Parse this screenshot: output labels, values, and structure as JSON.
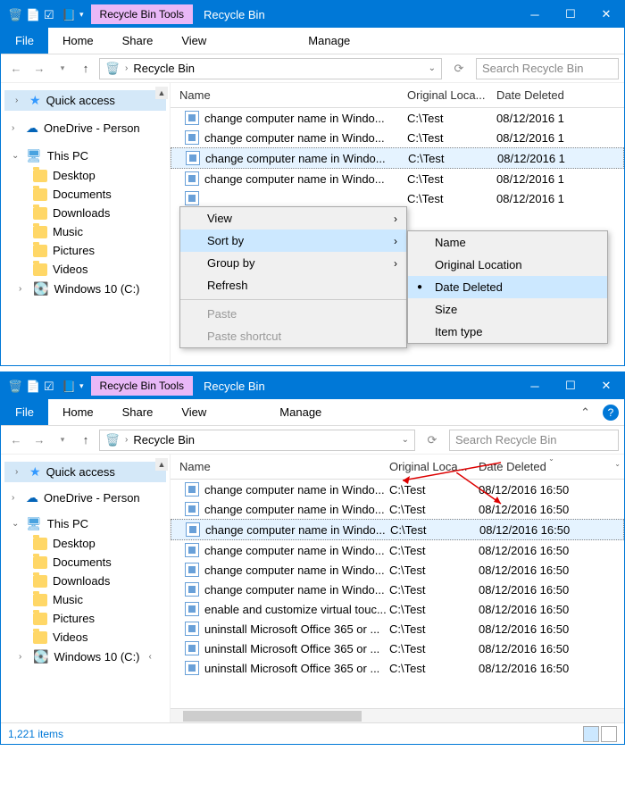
{
  "window1": {
    "title": "Recycle Bin",
    "contextualTab": "Recycle Bin Tools",
    "ribbon": {
      "file": "File",
      "tabs": [
        "Home",
        "Share",
        "View"
      ],
      "contextual": "Manage"
    },
    "breadcrumb": {
      "loc": "Recycle Bin"
    },
    "search": {
      "placeholder": "Search Recycle Bin"
    },
    "navPane": {
      "quick": "Quick access",
      "onedrive": "OneDrive - Person",
      "thispc": "This PC",
      "children": [
        "Desktop",
        "Documents",
        "Downloads",
        "Music",
        "Pictures",
        "Videos",
        "Windows 10 (C:)"
      ]
    },
    "columns": {
      "name": "Name",
      "orig": "Original Loca...",
      "date": "Date Deleted"
    },
    "rows": [
      {
        "name": "change computer name in Windo...",
        "orig": "C:\\Test",
        "date": "08/12/2016 1"
      },
      {
        "name": "change computer name in Windo...",
        "orig": "C:\\Test",
        "date": "08/12/2016 1"
      },
      {
        "name": "change computer name in Windo...",
        "orig": "C:\\Test",
        "date": "08/12/2016 1",
        "sel": true
      },
      {
        "name": "change computer name in Windo...",
        "orig": "C:\\Test",
        "date": "08/12/2016 1"
      },
      {
        "name": "",
        "orig": "C:\\Test",
        "date": "08/12/2016 1"
      }
    ],
    "ctxMenu": {
      "items": [
        {
          "label": "View",
          "sub": true
        },
        {
          "label": "Sort by",
          "sub": true,
          "hover": true
        },
        {
          "label": "Group by",
          "sub": true
        },
        {
          "label": "Refresh"
        },
        {
          "sep": true
        },
        {
          "label": "Paste",
          "disabled": true
        },
        {
          "label": "Paste shortcut",
          "disabled": true
        }
      ]
    },
    "sortMenu": {
      "items": [
        {
          "label": "Name"
        },
        {
          "label": "Original Location"
        },
        {
          "label": "Date Deleted",
          "checked": true,
          "hover": true
        },
        {
          "label": "Size"
        },
        {
          "label": "Item type"
        }
      ]
    }
  },
  "window2": {
    "title": "Recycle Bin",
    "contextualTab": "Recycle Bin Tools",
    "ribbon": {
      "file": "File",
      "tabs": [
        "Home",
        "Share",
        "View"
      ],
      "contextual": "Manage"
    },
    "breadcrumb": {
      "loc": "Recycle Bin"
    },
    "search": {
      "placeholder": "Search Recycle Bin"
    },
    "navPane": {
      "quick": "Quick access",
      "onedrive": "OneDrive - Person",
      "thispc": "This PC",
      "children": [
        "Desktop",
        "Documents",
        "Downloads",
        "Music",
        "Pictures",
        "Videos",
        "Windows 10 (C:)"
      ]
    },
    "columns": {
      "name": "Name",
      "orig": "Original Loca...",
      "date": "Date Deleted"
    },
    "rows": [
      {
        "name": "change computer name in Windo...",
        "orig": "C:\\Test",
        "date": "08/12/2016 16:50"
      },
      {
        "name": "change computer name in Windo...",
        "orig": "C:\\Test",
        "date": "08/12/2016 16:50"
      },
      {
        "name": "change computer name in Windo...",
        "orig": "C:\\Test",
        "date": "08/12/2016 16:50",
        "sel": true
      },
      {
        "name": "change computer name in Windo...",
        "orig": "C:\\Test",
        "date": "08/12/2016 16:50"
      },
      {
        "name": "change computer name in Windo...",
        "orig": "C:\\Test",
        "date": "08/12/2016 16:50"
      },
      {
        "name": "change computer name in Windo...",
        "orig": "C:\\Test",
        "date": "08/12/2016 16:50"
      },
      {
        "name": "enable and customize virtual touc...",
        "orig": "C:\\Test",
        "date": "08/12/2016 16:50"
      },
      {
        "name": "uninstall Microsoft Office 365 or ...",
        "orig": "C:\\Test",
        "date": "08/12/2016 16:50"
      },
      {
        "name": "uninstall Microsoft Office 365 or ...",
        "orig": "C:\\Test",
        "date": "08/12/2016 16:50"
      },
      {
        "name": "uninstall Microsoft Office 365 or ...",
        "orig": "C:\\Test",
        "date": "08/12/2016 16:50"
      }
    ],
    "status": {
      "count": "1,221 items"
    }
  }
}
